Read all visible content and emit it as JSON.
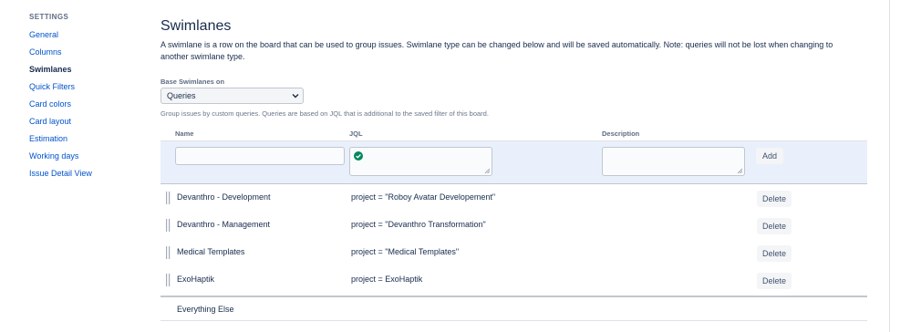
{
  "sidebar": {
    "heading": "SETTINGS",
    "items": [
      {
        "label": "General",
        "active": false
      },
      {
        "label": "Columns",
        "active": false
      },
      {
        "label": "Swimlanes",
        "active": true
      },
      {
        "label": "Quick Filters",
        "active": false
      },
      {
        "label": "Card colors",
        "active": false
      },
      {
        "label": "Card layout",
        "active": false
      },
      {
        "label": "Estimation",
        "active": false
      },
      {
        "label": "Working days",
        "active": false
      },
      {
        "label": "Issue Detail View",
        "active": false
      }
    ]
  },
  "main": {
    "title": "Swimlanes",
    "description": "A swimlane is a row on the board that can be used to group issues. Swimlane type can be changed below and will be saved automatically. Note: queries will not be lost when changing to another swimlane type.",
    "base_label": "Base Swimlanes on",
    "base_value": "Queries",
    "help_text": "Group issues by custom queries. Queries are based on JQL that is additional to the saved filter of this board."
  },
  "table": {
    "columns": {
      "name": "Name",
      "jql": "JQL",
      "description": "Description"
    },
    "add_label": "Add",
    "delete_label": "Delete",
    "rows": [
      {
        "name": "Devanthro - Development",
        "jql": "project = \"Roboy Avatar Developement\""
      },
      {
        "name": "Devanthro - Management",
        "jql": "project = \"Devanthro Transformation\""
      },
      {
        "name": "Medical Templates",
        "jql": "project = \"Medical Templates\""
      },
      {
        "name": "ExoHaptik",
        "jql": "project = ExoHaptik"
      }
    ],
    "everything_else": "Everything Else"
  },
  "colors": {
    "link": "#0052cc",
    "text": "#172b4d",
    "add_row_bg": "#e9f0fb",
    "valid_green": "#00875a"
  }
}
